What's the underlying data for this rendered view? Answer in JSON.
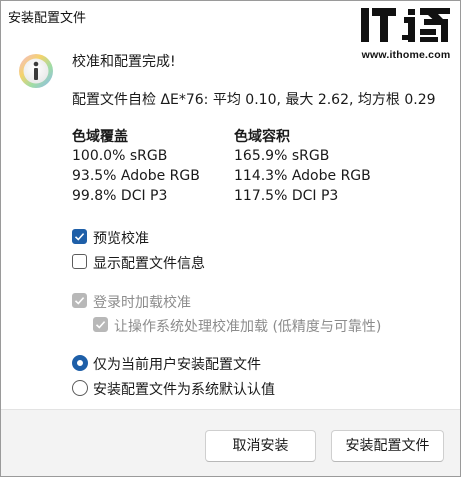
{
  "window": {
    "title": "安装配置文件"
  },
  "watermark": {
    "url": "www.ithome.com"
  },
  "icon": "info-icon",
  "message": {
    "heading": "校准和配置完成!",
    "self_check": "配置文件自检 ΔE*76: 平均 0.10, 最大 2.62, 均方根 0.29"
  },
  "gamut_coverage": {
    "title": "色域覆盖",
    "rows": [
      "100.0% sRGB",
      "93.5% Adobe RGB",
      "99.8% DCI P3"
    ]
  },
  "gamut_volume": {
    "title": "色域容积",
    "rows": [
      "165.9% sRGB",
      "114.3% Adobe RGB",
      "117.5% DCI P3"
    ]
  },
  "options": {
    "preview_calibration": {
      "label": "预览校准",
      "checked": true
    },
    "show_profile_info": {
      "label": "显示配置文件信息",
      "checked": false
    },
    "load_on_login": {
      "label": "登录时加载校准",
      "checked": true,
      "disabled": true
    },
    "os_handles_loading": {
      "label": "让操作系统处理校准加载 (低精度与可靠性)",
      "checked": true,
      "disabled": true
    }
  },
  "install_scope": {
    "current_user": {
      "label": "仅为当前用户安装配置文件",
      "selected": true
    },
    "system_default": {
      "label": "安装配置文件为系统默认认值",
      "selected": false
    }
  },
  "buttons": {
    "cancel": "取消安装",
    "install": "安装配置文件"
  },
  "colors": {
    "accent": "#1e5fa8",
    "footer_bg": "#f3f3f3",
    "disabled": "#b8b8b8"
  }
}
